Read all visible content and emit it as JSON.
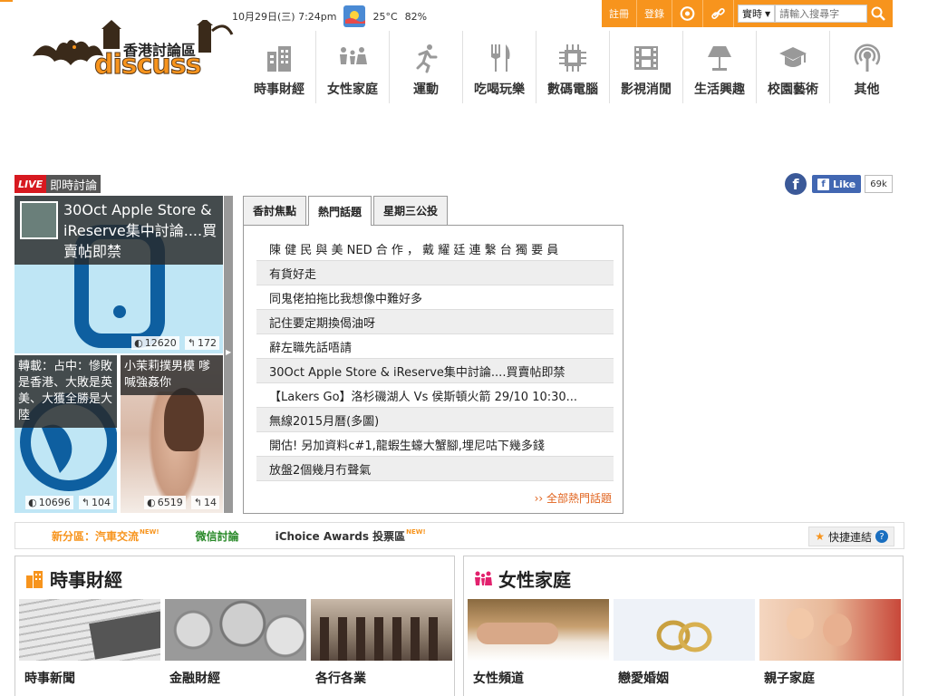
{
  "topbar": {
    "datetime": "10月29日(三) 7:24pm",
    "temperature": "25°C",
    "humidity": "82%",
    "weather_icon": "weather-icon",
    "register": "註冊",
    "login": "登錄",
    "search_mode": "實時",
    "search_placeholder": "請輸入搜尋字"
  },
  "logo": {
    "text": "discuss",
    "cn": "香港討論區"
  },
  "nav": [
    {
      "label": "時事財經"
    },
    {
      "label": "女性家庭"
    },
    {
      "label": "運動"
    },
    {
      "label": "吃喝玩樂"
    },
    {
      "label": "數碼電腦"
    },
    {
      "label": "影視消閒"
    },
    {
      "label": "生活興趣"
    },
    {
      "label": "校園藝術"
    },
    {
      "label": "其他"
    }
  ],
  "live": {
    "badge": "LIVE",
    "label": "即時討論"
  },
  "facebook": {
    "like": "Like",
    "count": "69k"
  },
  "featured": [
    {
      "title": "30Oct Apple Store & iReserve集中討論....買賣帖即禁",
      "views": "12620",
      "replies": "172"
    },
    {
      "title": "轉載：占中：慘敗是香港、大敗是英美、大獲全勝是大陸",
      "views": "10696",
      "replies": "104"
    },
    {
      "title": "小茉莉撲男模 嗲喊強姦你",
      "views": "6519",
      "replies": "14"
    }
  ],
  "tabs": [
    {
      "label": "香討焦點"
    },
    {
      "label": "熱門話題"
    },
    {
      "label": "星期三公投"
    }
  ],
  "topics": [
    "陳 健 民 與 美 NED 合 作 ， 戴 耀 廷 連 繫 台 獨 要 員",
    "有貨好走",
    "同鬼佬拍拖比我想像中難好多",
    "記住要定期換偈油呀",
    "辭左職先話唔請",
    "30Oct Apple Store & iReserve集中討論....買賣帖即禁",
    "【Lakers Go】洛杉磯湖人 Vs 侯斯頓火箭 29/10 10:30...",
    "無線2015月曆(多圖)",
    "開估! 另加資料c#1,龍蝦生蠔大蟹腳,埋尼咕下幾多錢",
    "放盤2個幾月冇聲氣"
  ],
  "more_topics": "›› 全部熱門話題",
  "quickbar": {
    "item1": "新分區：汽車交流",
    "item2": "微信討論",
    "item3": "iChoice Awards 投票區",
    "new_tag": "NEW!",
    "quick_links": "快捷連結"
  },
  "sections": [
    {
      "title": "時事財經",
      "items": [
        {
          "label": "時事新聞"
        },
        {
          "label": "金融財經"
        },
        {
          "label": "各行各業"
        }
      ]
    },
    {
      "title": "女性家庭",
      "items": [
        {
          "label": "女性頻道"
        },
        {
          "label": "戀愛婚姻"
        },
        {
          "label": "親子家庭"
        }
      ]
    }
  ],
  "colors": {
    "brand_orange": "#f7941d",
    "live_red": "#d71920",
    "facebook_blue": "#3b5998",
    "link_orange": "#e0621c"
  }
}
